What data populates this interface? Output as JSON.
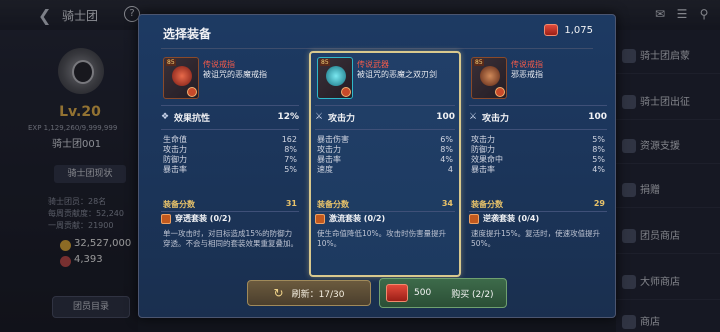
{
  "background": {
    "title": "骑士团",
    "level": "Lv.20",
    "exp": "EXP 1,129,260/9,999,999",
    "guild_name": "骑士团001",
    "status_button": "骑士团现状",
    "stats": [
      "骑士团员：28名",
      "每周贡献度：52,240",
      "一周贡献：21900"
    ],
    "gold": "32,527,000",
    "points": "4,393",
    "member_list_button": "团员目录",
    "menu": [
      "骑士团启蒙",
      "骑士团出征",
      "资源支援",
      "捐赠",
      "团员商店",
      "大师商店",
      "商店"
    ]
  },
  "modal": {
    "title": "选择装备",
    "currency": "1,075",
    "cards": [
      {
        "level": "85",
        "type": "传说戒指",
        "name": "被诅咒的恶魔戒指",
        "main_stat_label": "效果抗性",
        "main_stat_value": "12%",
        "sub_stats": [
          {
            "label": "生命值",
            "value": "162"
          },
          {
            "label": "攻击力",
            "value": "8%"
          },
          {
            "label": "防御力",
            "value": "7%"
          },
          {
            "label": "暴击率",
            "value": "5%"
          }
        ],
        "score_label": "装备分数",
        "score_value": "31",
        "set_name": "穿透套装 (0/2)",
        "set_desc": "单一攻击时，对目标造成15%的防御力穿透。不会与相同的套装效果重复叠加。",
        "art_color": "#c8302a"
      },
      {
        "level": "85",
        "type": "传说武器",
        "name": "被诅咒的恶魔之双刃剑",
        "main_stat_label": "攻击力",
        "main_stat_value": "100",
        "sub_stats": [
          {
            "label": "暴击伤害",
            "value": "6%"
          },
          {
            "label": "攻击力",
            "value": "8%"
          },
          {
            "label": "暴击率",
            "value": "4%"
          },
          {
            "label": "速度",
            "value": "4"
          }
        ],
        "score_label": "装备分数",
        "score_value": "34",
        "set_name": "激流套装 (0/2)",
        "set_desc": "使生命值降低10%。攻击时伤害量提升10%。",
        "art_color": "#2fb8c8"
      },
      {
        "level": "85",
        "type": "传说戒指",
        "name": "邪恶戒指",
        "main_stat_label": "攻击力",
        "main_stat_value": "100",
        "sub_stats": [
          {
            "label": "攻击力",
            "value": "5%"
          },
          {
            "label": "防御力",
            "value": "8%"
          },
          {
            "label": "效果命中",
            "value": "5%"
          },
          {
            "label": "暴击率",
            "value": "4%"
          }
        ],
        "score_label": "装备分数",
        "score_value": "29",
        "set_name": "逆袭套装 (0/4)",
        "set_desc": "速度提升15%。复活时，使速攻值提升50%。",
        "art_color": "#a84a2a"
      }
    ],
    "refresh": "刷新：17/30",
    "buy_price": "500",
    "buy_label": "购买 (2/2)"
  }
}
